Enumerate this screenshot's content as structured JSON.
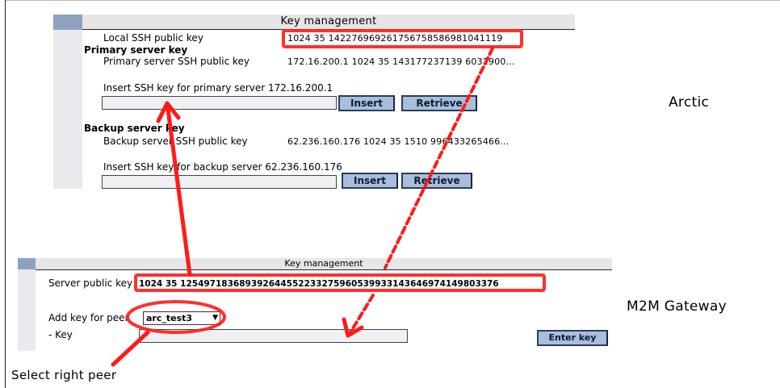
{
  "top_panel": {
    "header": "Key management",
    "local_key_label": "Local SSH public key",
    "local_key_value": "1024 35 142276969261756758586981041119",
    "primary_section": "Primary server key",
    "primary_key_label": "Primary server SSH public key",
    "primary_key_value": "172.16.200.1 1024 35 143177237139 6032900...",
    "insert_primary_label": "Insert SSH key for primary server 172.16.200.1",
    "insert_button": "Insert",
    "retrieve_button": "Retrieve",
    "backup_section": "Backup server key",
    "backup_key_label": "Backup server SSH public key",
    "backup_key_value": "62.236.160.176 1024 35 1510 996433265466...",
    "insert_backup_label": "Insert SSH key for backup server 62.236.160.176"
  },
  "bottom_panel": {
    "header": "Key management",
    "server_key_label": "Server public key",
    "server_key_value": "1024 35 125497183689392644552233275960539933143646974149803376",
    "add_key_label": "Add key for peer",
    "peer_selected": "arc_test3",
    "key_label": "- Key",
    "enter_key_button": "Enter key"
  },
  "labels": {
    "arctic": "Arctic",
    "m2m": "M2M Gateway",
    "select_peer": "Select right peer"
  },
  "colors": {
    "annotation": "#ff1a1a",
    "button_bg": "#a9bedb",
    "header_bg": "#e6e6e6",
    "sidebar_accent": "#8ea2c0"
  },
  "icons": {
    "dropdown": "chevron-down-icon"
  }
}
